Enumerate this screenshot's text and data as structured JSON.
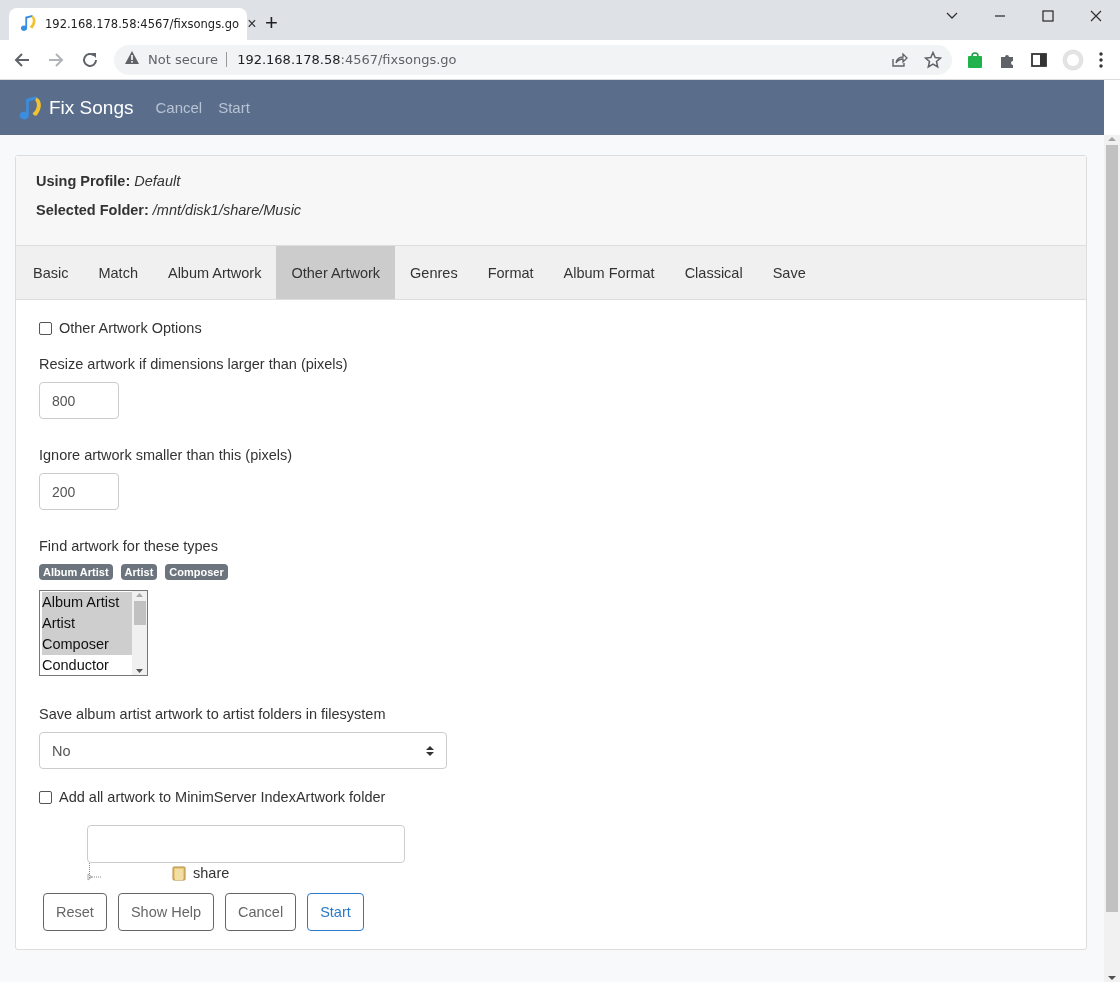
{
  "browser": {
    "tab_title": "192.168.178.58:4567/fixsongs.go",
    "tab_close": "×",
    "new_tab": "+",
    "security": "Not secure",
    "url_host": "192.168.178.58",
    "url_rest": ":4567/fixsongs.go"
  },
  "app": {
    "title": "Fix Songs",
    "nav": [
      "Cancel",
      "Start"
    ]
  },
  "info": [
    {
      "label": "Using Profile:",
      "value": "Default"
    },
    {
      "label": "Selected Folder:",
      "value": "/mnt/disk1/share/Music"
    }
  ],
  "tabs": [
    {
      "label": "Basic",
      "selected": false
    },
    {
      "label": "Match",
      "selected": false
    },
    {
      "label": "Album Artwork",
      "selected": false
    },
    {
      "label": "Other Artwork",
      "selected": true
    },
    {
      "label": "Genres",
      "selected": false
    },
    {
      "label": "Format",
      "selected": false
    },
    {
      "label": "Album Format",
      "selected": false
    },
    {
      "label": "Classical",
      "selected": false
    },
    {
      "label": "Save",
      "selected": false
    }
  ],
  "form": [
    {
      "kind": "checkbox",
      "label": "Other Artwork Options",
      "checked": false
    },
    {
      "kind": "number",
      "label": "Resize artwork if dimensions larger than (pixels)",
      "value": "800"
    },
    {
      "kind": "number",
      "label": "Ignore artwork smaller than this (pixels)",
      "value": "200"
    },
    {
      "kind": "multiselect",
      "label": "Find artwork for these types",
      "tags": [
        "Album Artist",
        "Artist",
        "Composer"
      ],
      "options": [
        {
          "label": "Album Artist",
          "selected": true
        },
        {
          "label": "Artist",
          "selected": true
        },
        {
          "label": "Composer",
          "selected": true
        },
        {
          "label": "Conductor",
          "selected": false
        }
      ]
    },
    {
      "kind": "select",
      "label": "Save album artist artwork to artist folders in filesystem",
      "value": "No"
    },
    {
      "kind": "checkbox",
      "label": "Add all artwork to MinimServer IndexArtwork folder",
      "checked": false
    },
    {
      "kind": "folder_tree",
      "node": "share"
    }
  ],
  "buttons": [
    {
      "label": "Reset",
      "kind": "default"
    },
    {
      "label": "Show Help",
      "kind": "default"
    },
    {
      "label": "Cancel",
      "kind": "default"
    },
    {
      "label": "Start",
      "kind": "primary"
    }
  ]
}
